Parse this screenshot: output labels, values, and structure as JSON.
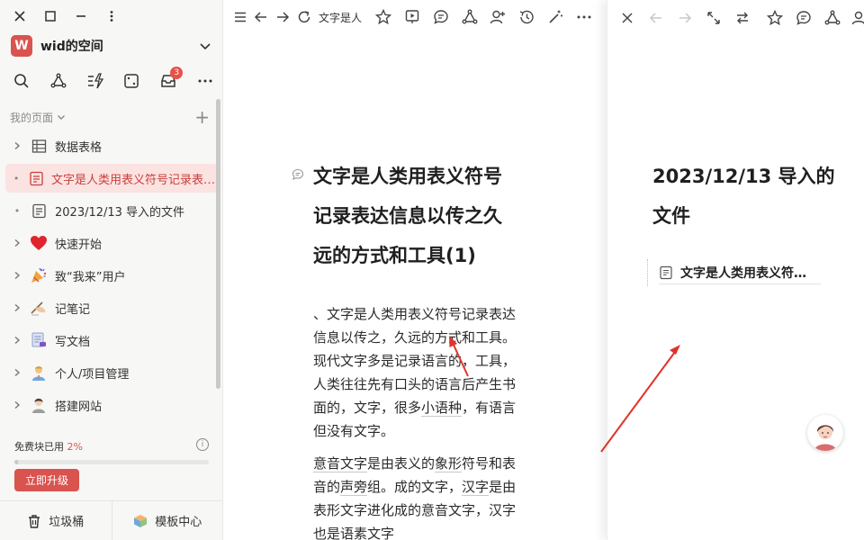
{
  "sidebar": {
    "space_name": "wid的空间",
    "space_logo_letter": "W",
    "notification_count": "3",
    "section_label": "我的页面",
    "items": [
      {
        "label": "数据表格",
        "icon": "table-icon"
      },
      {
        "label": "文字是人类用表义符号记录表达信息以传之久远的方式和工具(1)",
        "icon": "page-icon",
        "active": true
      },
      {
        "label": "2023/12/13 导入的文件",
        "icon": "page-icon"
      },
      {
        "label": "快速开始",
        "icon": "heart-icon"
      },
      {
        "label": "致“我来”用户",
        "icon": "party-popper-icon"
      },
      {
        "label": "记笔记",
        "icon": "writing-hand-icon"
      },
      {
        "label": "写文档",
        "icon": "document-icon"
      },
      {
        "label": "个人/项目管理",
        "icon": "manager-person-icon"
      },
      {
        "label": "搭建网站",
        "icon": "web-builder-person-icon"
      }
    ],
    "usage_label": "免费块已用",
    "usage_percent_text": "2%",
    "usage_fraction": 0.02,
    "upgrade_label": "立即升级",
    "trash_label": "垃圾桶",
    "template_label": "模板中心"
  },
  "middle": {
    "tab_title": "文字是人",
    "title": "文字是人类用表义符号记录表达信息以传之久远的方式和工具(1)",
    "para1": {
      "a": "、文字是人类用表义符号记录表达信息以传之，久远的方式和工具。现代文字多是记录语言的，工具，人类往往先有口头的语言后产生书面的，文字，很多",
      "b": "小语种",
      "c": "，有语言但没有文字。"
    },
    "para2": {
      "a": "意音文字",
      "b": "是由表义的",
      "c": "象形",
      "d": "符号和表音的",
      "e": "声旁",
      "f": "组。成的文字，",
      "g": "汉字",
      "h": "是由表形文字进化成的意音文字，汉字也是",
      "i": "语素文字"
    }
  },
  "right": {
    "title": "2023/12/13 导入的文件",
    "subpage": "文字是人类用表义符号记录表达信息以传之久远的方式和工具(1)"
  },
  "colors": {
    "accent": "#d9534f",
    "active_bg": "#fbe3e2",
    "arrow": "#e0332b"
  }
}
